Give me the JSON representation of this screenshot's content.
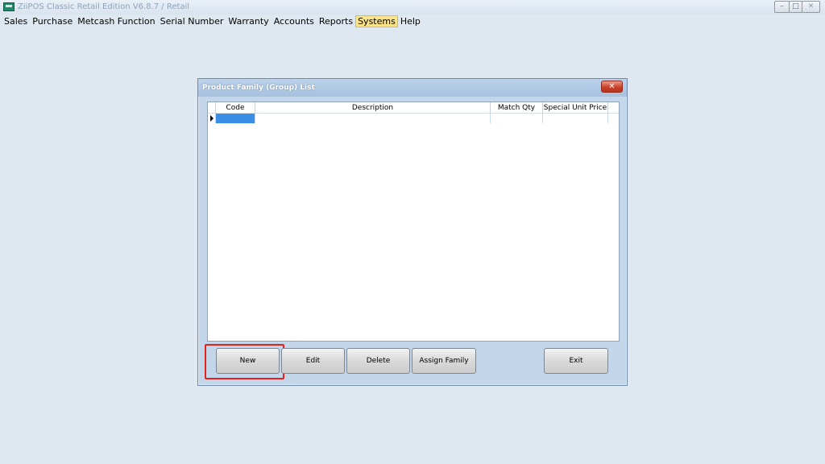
{
  "app": {
    "title": "ZiiPOS Classic Retail Edition V6.8.7 / Retail",
    "controls": {
      "minimize": "–",
      "maximize": "□",
      "close": "✕"
    }
  },
  "menubar": {
    "items": [
      {
        "label": "Sales"
      },
      {
        "label": "Purchase"
      },
      {
        "label": "Metcash Function"
      },
      {
        "label": "Serial Number"
      },
      {
        "label": "Warranty"
      },
      {
        "label": "Accounts"
      },
      {
        "label": "Reports"
      },
      {
        "label": "Systems",
        "active": true
      },
      {
        "label": "Help"
      }
    ]
  },
  "dialog": {
    "title": "Product Family (Group) List",
    "close_label": "✕",
    "grid": {
      "columns": [
        "Code",
        "Description",
        "Match Qty",
        "Special Unit Price"
      ],
      "rows": [
        {
          "code": "",
          "description": "",
          "match_qty": "",
          "special_unit_price": ""
        }
      ]
    },
    "buttons": {
      "new": "New",
      "edit": "Edit",
      "delete": "Delete",
      "assign_family": "Assign Family",
      "exit": "Exit"
    }
  },
  "colors": {
    "desktop": "#dfe8f1",
    "dialog_frame": "#c4d6ea",
    "selected_cell": "#3a8ee6",
    "active_menu": "#fbe38a",
    "highlight": "#e8211d"
  }
}
